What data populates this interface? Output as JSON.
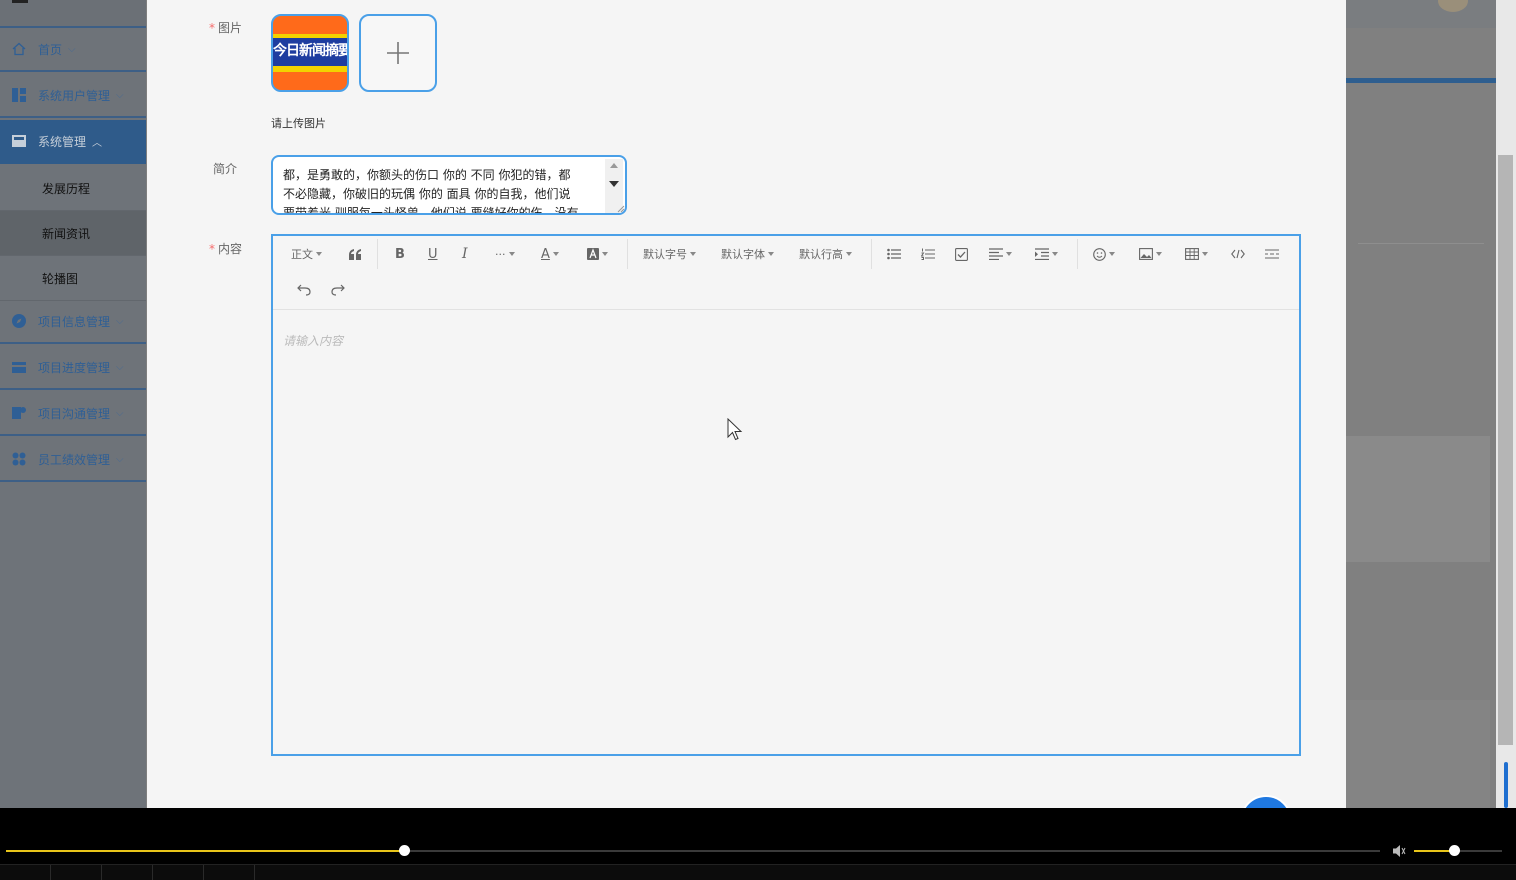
{
  "sidebar": {
    "groups": [
      {
        "label": "首页",
        "icon": "home-icon"
      },
      {
        "label": "系统用户管理",
        "icon": "dashboard-icon"
      },
      {
        "label": "系统管理",
        "icon": "store-icon",
        "expanded": true
      },
      {
        "label": "项目信息管理",
        "icon": "compass-icon"
      },
      {
        "label": "项目进度管理",
        "icon": "card-icon"
      },
      {
        "label": "项目沟通管理",
        "icon": "chat-icon"
      },
      {
        "label": "员工绩效管理",
        "icon": "grid-icon"
      }
    ],
    "sub_items": [
      "发展历程",
      "新闻资讯",
      "轮播图"
    ],
    "selected_sub_item": "新闻资讯"
  },
  "form": {
    "image_label": "图片",
    "image_thumb_text": "今日新闻摘要",
    "upload_tip": "请上传图片",
    "intro_label": "简介",
    "intro_lines": [
      "都，是勇敢的，你额头的伤口 你的 不同 你犯的错，都",
      "不必隐藏，你破旧的玩偶 你的 面具 你的自我，他们说",
      "要带着光 驯服每一头怪兽，他们说 要缝好你的伤，没有"
    ],
    "content_label": "内容",
    "content_placeholder": "请输入内容"
  },
  "editor_toolbar": {
    "paragraph": "正文",
    "font_size": "默认字号",
    "font_family": "默认字体",
    "line_height": "默认行高",
    "more": "···",
    "font_color": "A"
  },
  "player": {
    "progress": 0.29,
    "volume": 0.45
  },
  "colors": {
    "accent": "#4aa0e8",
    "required": "#f56c6c",
    "seek": "#e8c51a",
    "menu_active": "#2f5b8a"
  }
}
